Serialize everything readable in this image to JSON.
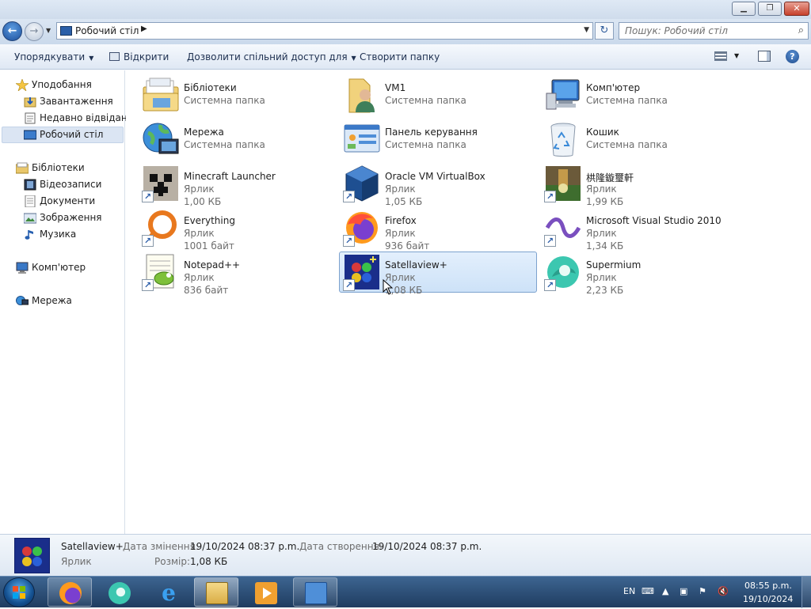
{
  "window": {
    "controls": {
      "minimize": "▁",
      "maximize": "❐",
      "close": "✕"
    }
  },
  "nav_buttons": {
    "back": "←",
    "forward": "→"
  },
  "address": {
    "path": "Робочий стіл",
    "separator": "▶",
    "dropdown": "▼",
    "refresh": "↻"
  },
  "search": {
    "placeholder": "Пошук: Робочий стіл"
  },
  "toolbar": {
    "organize": "Упорядкувати",
    "open": "Відкрити",
    "share": "Дозволити спільний доступ для",
    "new_folder": "Створити папку",
    "dropdown_arrow": "▼",
    "help": "?"
  },
  "sidebar": {
    "favorites": "Уподобання",
    "downloads": "Завантаження",
    "recent": "Недавно відвідане",
    "desktop": "Робочий стіл",
    "libraries": "Бібліотеки",
    "videos": "Відеозаписи",
    "documents": "Документи",
    "pictures": "Зображення",
    "music": "Музика",
    "computer": "Комп'ютер",
    "network": "Мережа"
  },
  "items": [
    {
      "name": "Бібліотеки",
      "line1": "Системна папка",
      "line2": "",
      "icon": "libraries-icon"
    },
    {
      "name": "VM1",
      "line1": "Системна папка",
      "line2": "",
      "icon": "user-folder-icon"
    },
    {
      "name": "Комп'ютер",
      "line1": "Системна папка",
      "line2": "",
      "icon": "computer-icon"
    },
    {
      "name": "Мережа",
      "line1": "Системна папка",
      "line2": "",
      "icon": "network-icon"
    },
    {
      "name": "Панель керування",
      "line1": "Системна папка",
      "line2": "",
      "icon": "control-panel-icon"
    },
    {
      "name": "Кошик",
      "line1": "Системна папка",
      "line2": "",
      "icon": "recycle-bin-icon"
    },
    {
      "name": "Minecraft Launcher",
      "line1": "Ярлик",
      "line2": "1,00 КБ",
      "icon": "minecraft-icon"
    },
    {
      "name": "Oracle VM VirtualBox",
      "line1": "Ярлик",
      "line2": "1,05 КБ",
      "icon": "virtualbox-icon"
    },
    {
      "name": "栱隆鏇璽軒",
      "line1": "Ярлик",
      "line2": "1,99 КБ",
      "icon": "game-icon"
    },
    {
      "name": "Everything",
      "line1": "Ярлик",
      "line2": "1001 байт",
      "icon": "everything-icon"
    },
    {
      "name": "Firefox",
      "line1": "Ярлик",
      "line2": "936 байт",
      "icon": "firefox-icon"
    },
    {
      "name": "Microsoft Visual Studio 2010",
      "line1": "Ярлик",
      "line2": "1,34 КБ",
      "icon": "visual-studio-icon"
    },
    {
      "name": "Notepad++",
      "line1": "Ярлик",
      "line2": "836 байт",
      "icon": "notepadpp-icon"
    },
    {
      "name": "Satellaview+",
      "line1": "Ярлик",
      "line2": "1,08 КБ",
      "icon": "satellaview-icon",
      "selected": true
    },
    {
      "name": "Supermium",
      "line1": "Ярлик",
      "line2": "2,23 КБ",
      "icon": "supermium-icon"
    }
  ],
  "details": {
    "name": "Satellaview+",
    "type": "Ярлик",
    "modified_label": "Дата змінення:",
    "modified_value": "19/10/2024 08:37 p.m.",
    "created_label": "Дата створення:",
    "created_value": "19/10/2024 08:37 p.m.",
    "size_label": "Розмір:",
    "size_value": "1,08 КБ"
  },
  "taskbar": {
    "apps": [
      "firefox-icon",
      "supermium-icon",
      "internet-explorer-icon",
      "explorer-icon",
      "media-player-icon",
      "control-panel-icon"
    ],
    "language": "EN",
    "time": "08:55 p.m.",
    "date": "19/10/2024"
  }
}
